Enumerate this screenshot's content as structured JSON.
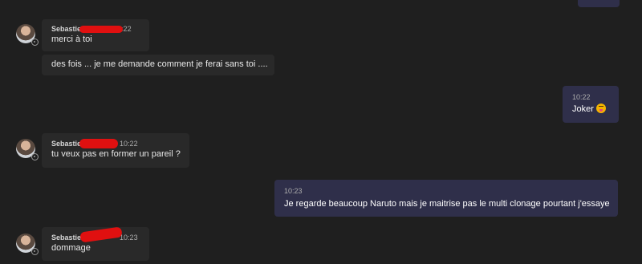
{
  "colors": {
    "background": "#1f1f1f",
    "incoming_bubble": "#292929",
    "outgoing_bubble": "#2f2f4a",
    "redaction": "#e01010"
  },
  "messages": [
    {
      "sender": "Sebastien",
      "time": "10:22",
      "text": "merci à toi"
    },
    {
      "text": "des fois ... je me demande comment je ferai sans toi ...."
    },
    {
      "time": "10:22",
      "text": "Joker",
      "emoji": "tongue-out-emoji"
    },
    {
      "sender": "Sebastien",
      "time": "10:22",
      "text": "tu veux pas en former un pareil ?"
    },
    {
      "time": "10:23",
      "text": "Je regarde beaucoup Naruto mais je maitrise pas le multi clonage pourtant j'essaye"
    },
    {
      "sender": "Sebastien",
      "time": "10:23",
      "text": "dommage"
    }
  ]
}
